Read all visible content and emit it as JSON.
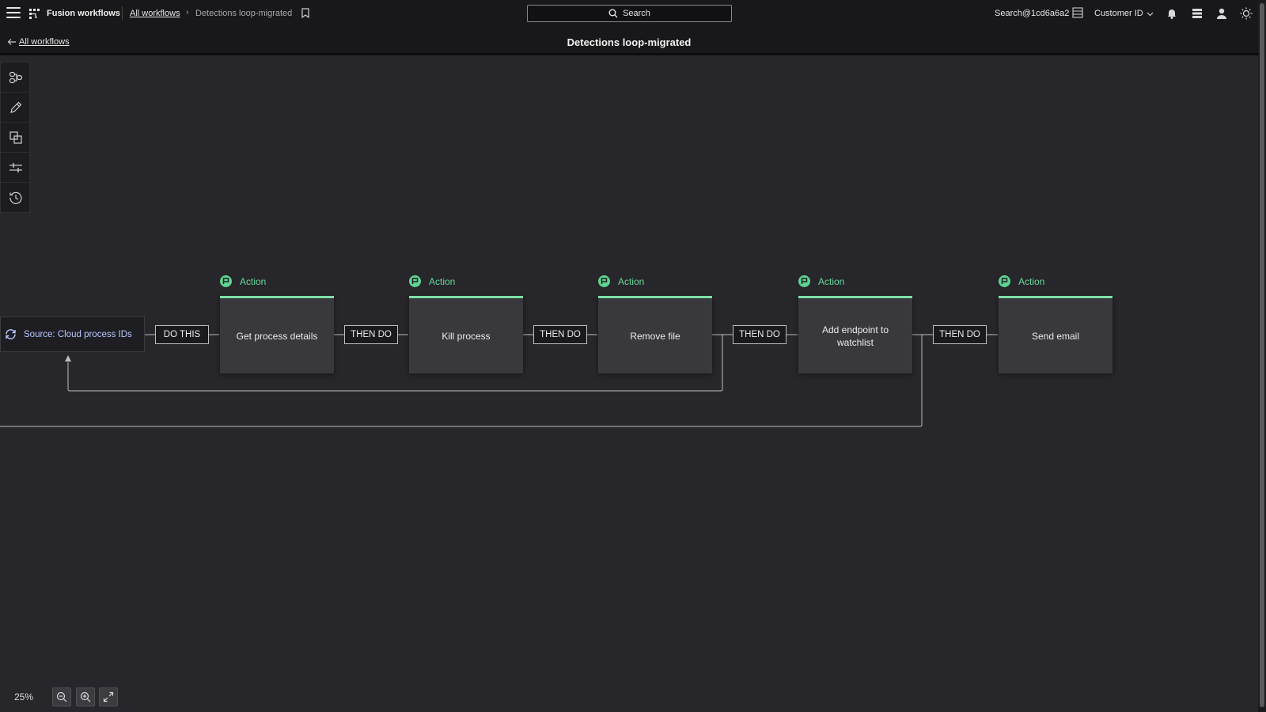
{
  "header": {
    "app_name": "Fusion workflows",
    "breadcrumb_link": "All workflows",
    "breadcrumb_sep": "›",
    "breadcrumb_current": "Detections loop-migrated",
    "search_label": "Search",
    "account": "Search@1cd6a6a2",
    "customer_label": "Customer ID"
  },
  "subheader": {
    "back_label": "All workflows",
    "title": "Detections loop-migrated"
  },
  "tool_rail": [
    "workflow-icon",
    "pencil-icon",
    "copy-icon",
    "sliders-icon",
    "history-icon"
  ],
  "workflow": {
    "source": "Source: Cloud process IDs",
    "connectors": [
      "DO THIS",
      "THEN DO",
      "THEN DO",
      "THEN DO",
      "THEN DO"
    ],
    "action_type_label": "Action",
    "actions": [
      "Get process details",
      "Kill process",
      "Remove file",
      "Add endpoint to watchlist",
      "Send email"
    ]
  },
  "zoom": {
    "level": "25%"
  },
  "colors": {
    "accent_green": "#7be0a6",
    "background": "#26262b",
    "topbar": "#18181b"
  }
}
